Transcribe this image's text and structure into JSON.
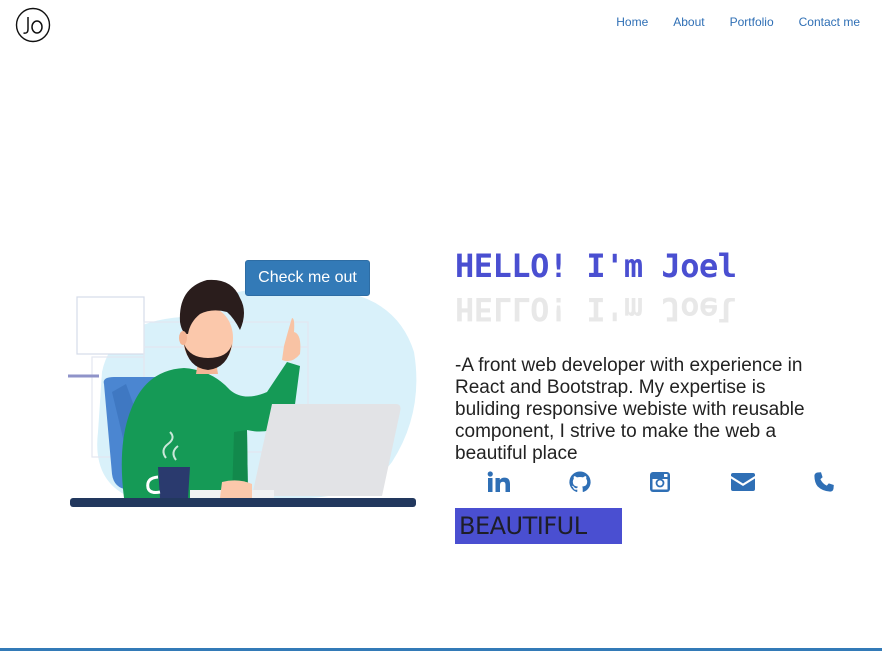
{
  "logo": {
    "text": "JO",
    "icon": "jo-logo-icon"
  },
  "nav": {
    "items": [
      {
        "label": "Home"
      },
      {
        "label": "About"
      },
      {
        "label": "Portfolio"
      },
      {
        "label": "Contact me"
      }
    ]
  },
  "hero": {
    "cta_label": "Check me out",
    "title": "HELLO! I'm Joel",
    "description": "-A front web developer with experience in React and Bootstrap. My expertise is buliding responsive webiste with reusable component, I strive to make the web a beautiful place",
    "typed_word": "BEAUTIFUL"
  },
  "socials": [
    {
      "name": "linkedin-icon"
    },
    {
      "name": "github-icon"
    },
    {
      "name": "instagram-icon"
    },
    {
      "name": "envelope-icon"
    },
    {
      "name": "phone-icon"
    }
  ],
  "colors": {
    "accent": "#4a4fd1",
    "link": "#2f6fb5",
    "button": "#337ab7",
    "icon": "#2f6fb5"
  }
}
